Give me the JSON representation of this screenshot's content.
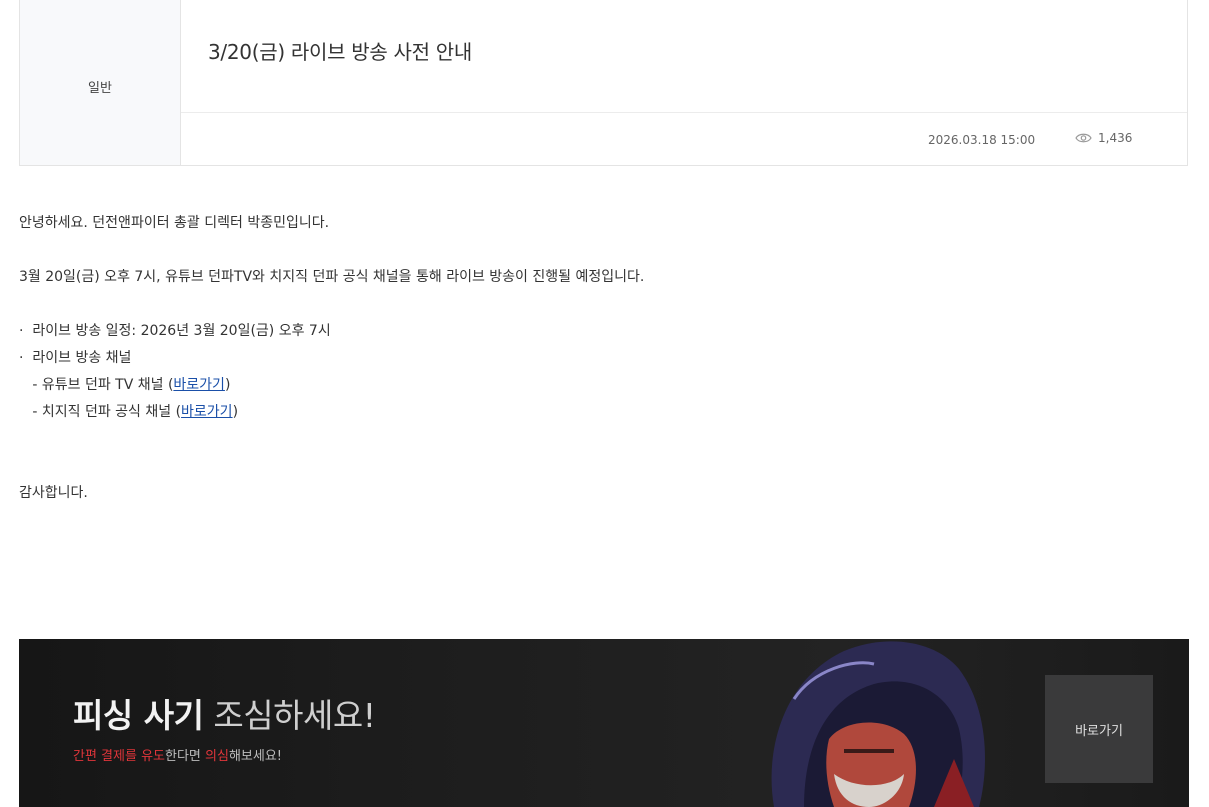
{
  "post": {
    "category": "일반",
    "title": "3/20(금) 라이브 방송 사전 안내",
    "date": "2026.03.18 15:00",
    "views": "1,436",
    "view_icon": "eye-icon"
  },
  "body": {
    "greeting": "안녕하세요. 던전앤파이터 총괄 디렉터 박종민입니다.",
    "intro": "3월 20일(금) 오후 7시, 유튜브 던파TV와 치지직 던파 공식 채널을 통해 라이브 방송이 진행될 예정입니다.",
    "schedule": "·  라이브 방송 일정: 2026년 3월 20일(금) 오후 7시",
    "channels_label": "·  라이브 방송 채널",
    "youtube_prefix": "   - 유튜브 던파 TV 채널 (",
    "youtube_link": "바로가기",
    "chzzk_prefix": "   - 치지직 던파 공식 채널 (",
    "chzzk_link": "바로가기",
    "close_paren": ")",
    "thanks": "감사합니다."
  },
  "banner": {
    "title_bold": "피싱 사기",
    "title_thin": " 조심하세요!",
    "sub_red1": "간편 결제를 유도",
    "sub_normal1": "한다면 ",
    "sub_red2": "의심",
    "sub_normal2": "해보세요!",
    "button_label": "바로가기",
    "accent_color": "#e0353a"
  }
}
